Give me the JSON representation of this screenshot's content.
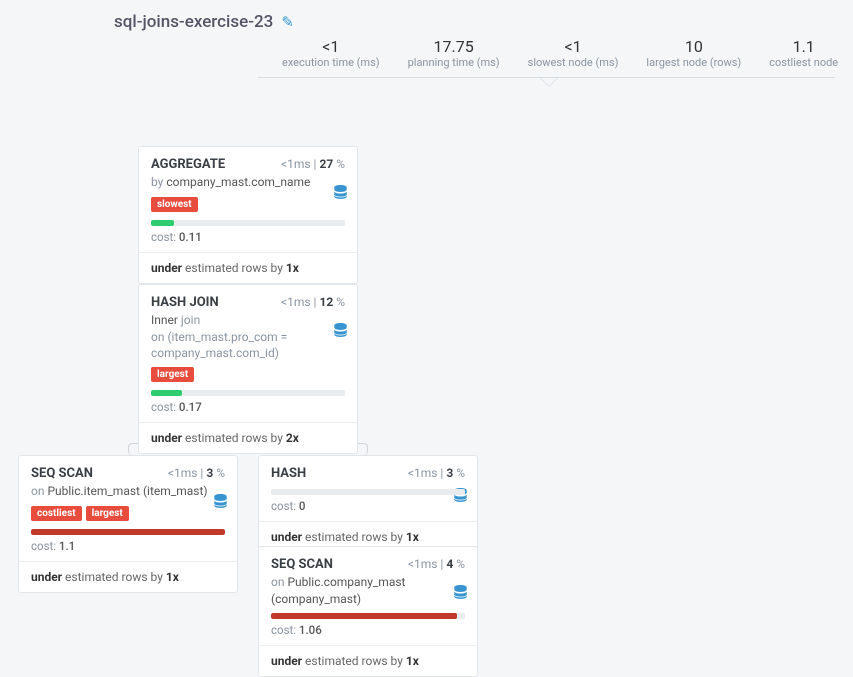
{
  "title": "sql-joins-exercise-23",
  "stats": [
    {
      "value": "<1",
      "label": "execution time (ms)"
    },
    {
      "value": "17.75",
      "label": "planning time (ms)"
    },
    {
      "value": "<1",
      "label": "slowest node (ms)"
    },
    {
      "value": "10",
      "label": "largest node (rows)"
    },
    {
      "value": "1.1",
      "label": "costliest node"
    }
  ],
  "nodes": {
    "aggregate": {
      "title": "AGGREGATE",
      "time_prefix": "<1ms | ",
      "time_pct": "27",
      "time_suffix": " %",
      "sub_prefix": "by ",
      "sub_value": "company_mast.com_name",
      "tag1": "slowest",
      "cost_label": "cost: ",
      "cost_value": "0.11",
      "foot_b1": "under",
      "foot_mid": " estimated rows by ",
      "foot_b2": "1x"
    },
    "hashjoin": {
      "title": "HASH JOIN",
      "time_prefix": "<1ms | ",
      "time_pct": "12",
      "time_suffix": " %",
      "sub_dk": "Inner",
      "sub_join": " join",
      "sub_on": "on (item_mast.pro_com = company_mast.com_id)",
      "tag1": "largest",
      "cost_label": "cost: ",
      "cost_value": "0.17",
      "foot_b1": "under",
      "foot_mid": " estimated rows by ",
      "foot_b2": "2x"
    },
    "seqscan1": {
      "title": "SEQ SCAN",
      "time_prefix": "<1ms | ",
      "time_pct": "3",
      "time_suffix": " %",
      "sub_prefix": "on ",
      "sub_value": "Public.item_mast (item_mast)",
      "tag1": "costliest",
      "tag2": "largest",
      "cost_label": "cost: ",
      "cost_value": "1.1",
      "foot_b1": "under",
      "foot_mid": " estimated rows by ",
      "foot_b2": "1x"
    },
    "hash": {
      "title": "HASH",
      "time_prefix": "<1ms | ",
      "time_pct": "3",
      "time_suffix": " %",
      "cost_label": "cost: ",
      "cost_value": "0",
      "foot_b1": "under",
      "foot_mid": " estimated rows by ",
      "foot_b2": "1x"
    },
    "seqscan2": {
      "title": "SEQ SCAN",
      "time_prefix": "<1ms | ",
      "time_pct": "4",
      "time_suffix": " %",
      "sub_prefix": "on ",
      "sub_value": "Public.company_mast (company_mast)",
      "cost_label": "cost: ",
      "cost_value": "1.06",
      "foot_b1": "under",
      "foot_mid": " estimated rows by ",
      "foot_b2": "1x"
    }
  }
}
